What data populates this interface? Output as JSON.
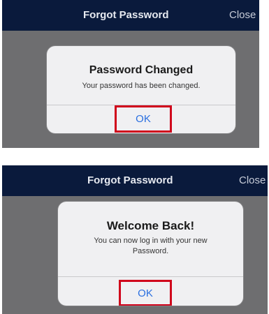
{
  "screens": [
    {
      "navbar": {
        "title": "Forgot Password",
        "close_label": "Close"
      },
      "dialog": {
        "title": "Password Changed",
        "message": "Your password has been changed.",
        "ok_label": "OK"
      }
    },
    {
      "navbar": {
        "title": "Forgot Password",
        "close_label": "Close"
      },
      "dialog": {
        "title": "Welcome Back!",
        "message": "You can now log in with your new Password.",
        "ok_label": "OK"
      }
    }
  ],
  "colors": {
    "navbar_bg": "#0a1a3c",
    "overlay_bg": "#6e6e70",
    "dialog_bg": "#f0f0f2",
    "ok_text": "#2a6fe0",
    "highlight_border": "#d0021b"
  }
}
